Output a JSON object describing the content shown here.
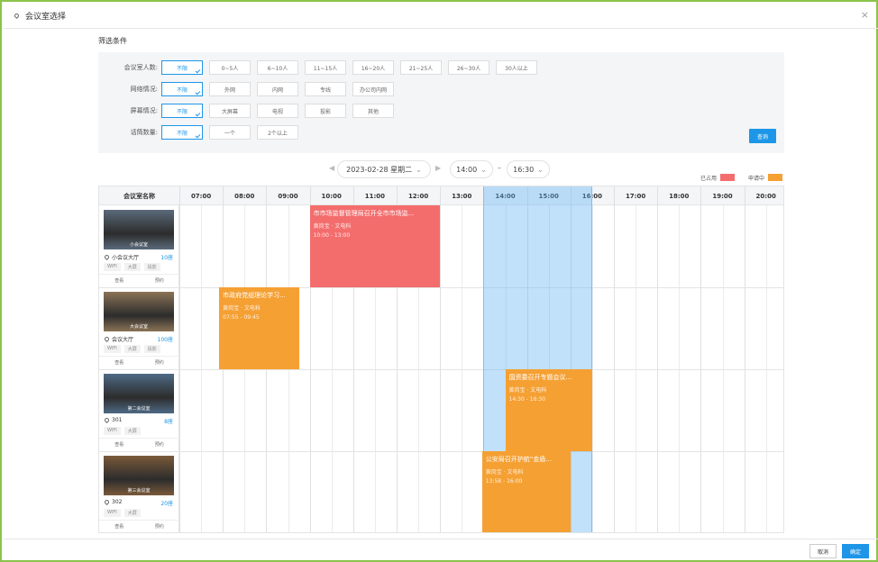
{
  "dialog": {
    "title": "会议室选择",
    "close_label": "×"
  },
  "filters": {
    "heading": "筛选条件",
    "rows": [
      {
        "label": "会议室人数:",
        "options": [
          "不限",
          "0~5人",
          "6~10人",
          "11~15人",
          "16~20人",
          "21~25人",
          "26~30人",
          "30人以上"
        ],
        "selected": 0
      },
      {
        "label": "网络情况:",
        "options": [
          "不限",
          "外网",
          "内网",
          "专线",
          "办公司内网"
        ],
        "selected": 0
      },
      {
        "label": "屏幕情况:",
        "options": [
          "不限",
          "大屏幕",
          "电视",
          "投影",
          "其他"
        ],
        "selected": 0
      },
      {
        "label": "话筒数量:",
        "options": [
          "不限",
          "一个",
          "2个以上"
        ],
        "selected": 0
      }
    ],
    "query_label": "查询"
  },
  "datebar": {
    "date": "2023-02-28 星期二",
    "prev_icon": "◀",
    "next_icon": "▶",
    "start_time": "14:00",
    "end_time": "16:30",
    "separator": "–"
  },
  "legend": [
    {
      "label": "已占用",
      "color": "#f46d6d"
    },
    {
      "label": "申请中",
      "color": "#f5a033"
    }
  ],
  "schedule": {
    "room_header": "会议室名称",
    "hours": [
      "07:00",
      "08:00",
      "09:00",
      "10:00",
      "11:00",
      "12:00",
      "13:00",
      "14:00",
      "15:00",
      "16:00",
      "17:00",
      "18:00",
      "19:00",
      "20:00"
    ],
    "selection": {
      "start": "14:00",
      "end": "16:30"
    },
    "rooms": [
      {
        "photo_caption": "小会议室",
        "name": "小会议大厅",
        "capacity": "10座",
        "tags": [
          "WIFI",
          "大屏",
          "投影"
        ],
        "actions": [
          "查看",
          "预约"
        ],
        "photo_color": "#5a6a7a"
      },
      {
        "photo_caption": "大会议室",
        "name": "会议大厅",
        "capacity": "100座",
        "tags": [
          "WIFI",
          "大屏",
          "投影"
        ],
        "actions": [
          "查看",
          "预约"
        ],
        "photo_color": "#8a7356"
      },
      {
        "photo_caption": "第二会议室",
        "name": "301",
        "capacity": "8座",
        "tags": [
          "WIFI",
          "大屏"
        ],
        "actions": [
          "查看",
          "预约"
        ],
        "photo_color": "#4e6a84"
      },
      {
        "photo_caption": "第三会议室",
        "name": "302",
        "capacity": "20座",
        "tags": [
          "WIFI",
          "大屏"
        ],
        "actions": [
          "查看",
          "预约"
        ],
        "photo_color": "#7a5a3a"
      }
    ],
    "events": [
      {
        "room": 0,
        "title": "市市场监督管理局召开全市市场监...",
        "org": "黄岗宝 · 文电科",
        "time": "10:00 - 13:00",
        "status": "occupied",
        "start": 10.0,
        "end": 13.0
      },
      {
        "room": 1,
        "title": "市政府党组理论学习...",
        "org": "黄岗宝 · 文电科",
        "time": "07:55 - 09:45",
        "status": "pending",
        "start": 7.9167,
        "end": 9.75
      },
      {
        "room": 2,
        "title": "国资委召开专题会议...",
        "org": "黄岗宝 · 文电科",
        "time": "14:30 - 16:30",
        "status": "pending",
        "start": 14.5,
        "end": 16.5
      },
      {
        "room": 3,
        "title": "公安局召开护航“金盾...",
        "org": "黄岗宝 · 文电科",
        "time": "13:58 - 16:00",
        "status": "pending",
        "start": 13.967,
        "end": 16.0
      }
    ]
  },
  "footer": {
    "cancel_label": "取消",
    "ok_label": "确定"
  }
}
